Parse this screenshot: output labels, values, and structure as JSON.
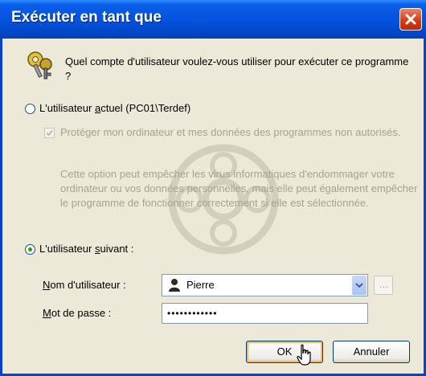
{
  "dialog": {
    "title": "Exécuter en tant que",
    "question": "Quel compte d'utilisateur voulez-vous utiliser pour exécuter ce programme ?",
    "option_current": {
      "label_pre": "L'utilisateur ",
      "label_access": "a",
      "label_post": "ctuel (PC01\\Terdef)",
      "selected": false
    },
    "protect": {
      "label": "Protéger mon ordinateur et mes données des programmes non autorisés.",
      "checked": true
    },
    "protect_note": "Cette option peut empêcher les virus informatiques d'endommager votre ordinateur ou vos données personnelles, mais elle peut également empêcher le programme de fonctionner correctement si elle est sélectionnée.",
    "option_following": {
      "label_pre": "L'utilisateur ",
      "label_access": "s",
      "label_post": "uivant :",
      "selected": true
    },
    "username": {
      "label_access": "N",
      "label_rest": "om d'utilisateur :",
      "value": "Pierre",
      "browse_label": "..."
    },
    "password": {
      "label_access": "M",
      "label_rest": "ot de passe :",
      "value": "••••••••••••"
    },
    "buttons": {
      "ok": "OK",
      "cancel": "Annuler"
    }
  },
  "icons": {
    "window_close": "close-icon",
    "keys": "keys-icon",
    "user": "user-icon",
    "dropdown": "chevron-down-icon",
    "cursor": "mouse-pointer-icon",
    "watermark": "watermark-emblem"
  },
  "colors": {
    "titlebar": "#0553E0",
    "face": "#ECE9D8",
    "disabled_text": "#A6A294",
    "close": "#D23A12",
    "radio_dot": "#21A121"
  }
}
